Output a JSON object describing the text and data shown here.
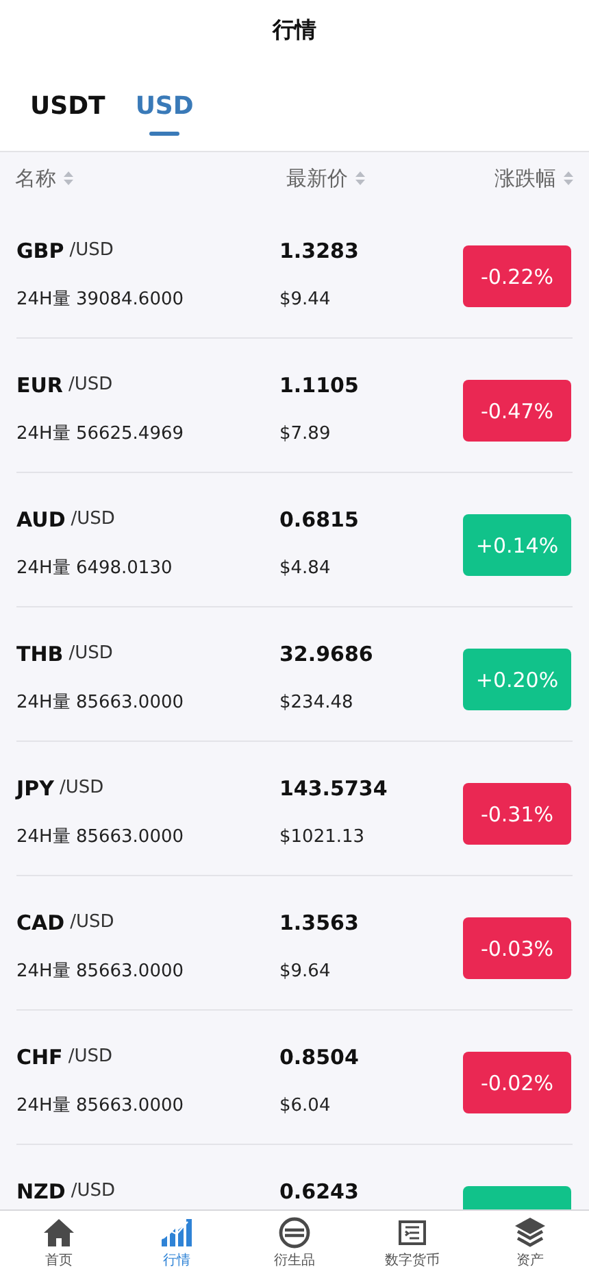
{
  "header": {
    "title": "行情"
  },
  "tabs": [
    {
      "label": "USDT",
      "selected": false
    },
    {
      "label": "USD",
      "selected": true
    }
  ],
  "columns": [
    "名称",
    "最新价",
    "涨跌幅"
  ],
  "rows": [
    {
      "base": "GBP",
      "quote": "/USD",
      "volume": "24H量 39084.6000",
      "price": "1.3283",
      "usd": "$9.44",
      "change": "-0.22%",
      "color": "#ea2853"
    },
    {
      "base": "EUR",
      "quote": "/USD",
      "volume": "24H量 56625.4969",
      "price": "1.1105",
      "usd": "$7.89",
      "change": "-0.47%",
      "color": "#ea2853"
    },
    {
      "base": "AUD",
      "quote": "/USD",
      "volume": "24H量 6498.0130",
      "price": "0.6815",
      "usd": "$4.84",
      "change": "+0.14%",
      "color": "#11c28a"
    },
    {
      "base": "THB",
      "quote": "/USD",
      "volume": "24H量 85663.0000",
      "price": "32.9686",
      "usd": "$234.48",
      "change": "+0.20%",
      "color": "#11c28a"
    },
    {
      "base": "JPY",
      "quote": "/USD",
      "volume": "24H量 85663.0000",
      "price": "143.5734",
      "usd": "$1021.13",
      "change": "-0.31%",
      "color": "#ea2853"
    },
    {
      "base": "CAD",
      "quote": "/USD",
      "volume": "24H量 85663.0000",
      "price": "1.3563",
      "usd": "$9.64",
      "change": "-0.03%",
      "color": "#ea2853"
    },
    {
      "base": "CHF",
      "quote": "/USD",
      "volume": "24H量 85663.0000",
      "price": "0.8504",
      "usd": "$6.04",
      "change": "-0.02%",
      "color": "#ea2853"
    },
    {
      "base": "NZD",
      "quote": "/USD",
      "price": "0.6243",
      "color": "#11c28a"
    }
  ],
  "nav": [
    {
      "label": "首页",
      "selected": false
    },
    {
      "label": "行情",
      "selected": true
    },
    {
      "label": "衍生品",
      "selected": false
    },
    {
      "label": "数字货币",
      "selected": false
    },
    {
      "label": "资产",
      "selected": false
    }
  ]
}
